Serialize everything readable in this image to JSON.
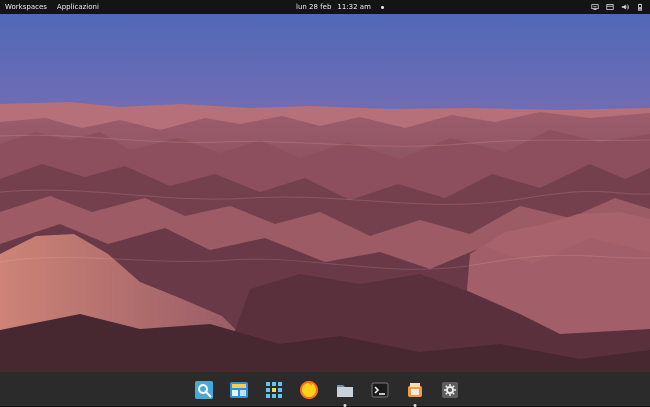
{
  "topbar": {
    "workspaces_label": "Workspaces",
    "apps_label": "Applicazioni",
    "date": "lun 28 feb",
    "time": "11:32 am"
  },
  "colors": {
    "topbar": "#141414",
    "dock": "#2b2b2b"
  },
  "tray_icons": [
    "network-icon",
    "window-icon",
    "volume-icon",
    "battery-icon"
  ],
  "dock_items": [
    {
      "name": "search-app-icon",
      "running": false
    },
    {
      "name": "app-center-icon",
      "running": false
    },
    {
      "name": "apps-grid-icon",
      "running": false
    },
    {
      "name": "firefox-icon",
      "running": false
    },
    {
      "name": "files-icon",
      "running": true
    },
    {
      "name": "terminal-icon",
      "running": false
    },
    {
      "name": "store-icon",
      "running": true
    },
    {
      "name": "settings-icon",
      "running": false
    }
  ]
}
